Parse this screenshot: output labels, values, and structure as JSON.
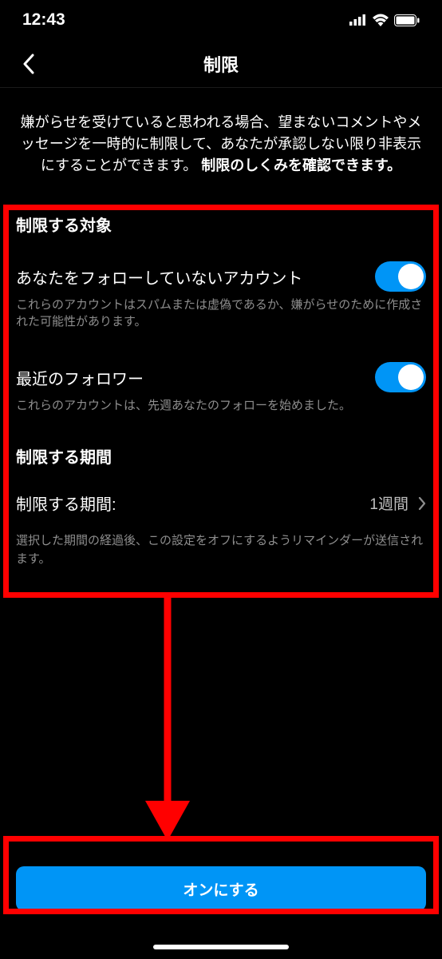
{
  "status": {
    "time": "12:43"
  },
  "header": {
    "title": "制限"
  },
  "description": {
    "text": "嫌がらせを受けていると思われる場合、望まないコメントやメッセージを一時的に制限して、あなたが承認しない限り非表示にすることができます。",
    "bold": "制限のしくみを確認できます。"
  },
  "sections": {
    "targets": {
      "title": "制限する対象",
      "items": [
        {
          "label": "あなたをフォローしていないアカウント",
          "sub": "これらのアカウントはスパムまたは虚偽であるか、嫌がらせのために作成された可能性があります。",
          "on": true
        },
        {
          "label": "最近のフォロワー",
          "sub": "これらのアカウントは、先週あなたのフォローを始めました。",
          "on": true
        }
      ]
    },
    "duration": {
      "title": "制限する期間",
      "row_label": "制限する期間:",
      "value": "1週間",
      "note": "選択した期間の経過後、この設定をオフにするようリマインダーが送信されます。"
    }
  },
  "cta": {
    "label": "オンにする"
  }
}
